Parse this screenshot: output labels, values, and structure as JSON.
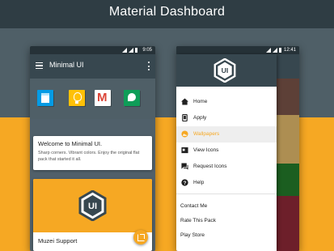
{
  "headline": "Material Dashboard",
  "left_phone": {
    "status_time": "9:05",
    "app_title": "Minimal UI",
    "welcome_card": {
      "title": "Welcome to Minimal UI.",
      "body": "Sharp corners. Vibrant colors. Enjoy the original flat pack that started it all."
    },
    "muzei_card": {
      "label": "Muzei Support",
      "logo_text": "UI"
    }
  },
  "right_phone": {
    "status_time": "12:41",
    "logo_text": "UI",
    "nav_items": [
      {
        "label": "Home",
        "icon": "home-icon"
      },
      {
        "label": "Apply",
        "icon": "apply-icon"
      },
      {
        "label": "Wallpapers",
        "icon": "wallpapers-icon",
        "active": true
      },
      {
        "label": "View Icons",
        "icon": "view-icons-icon"
      },
      {
        "label": "Request Icons",
        "icon": "request-icons-icon"
      },
      {
        "label": "Help",
        "icon": "help-icon"
      }
    ],
    "secondary_items": [
      "Contact Me",
      "Rate This Pack",
      "Play Store"
    ]
  },
  "colors": {
    "accent": "#f6a823",
    "toolbar": "#37474f",
    "status_bar": "#263238",
    "active_item_bg": "#eeeeee"
  }
}
